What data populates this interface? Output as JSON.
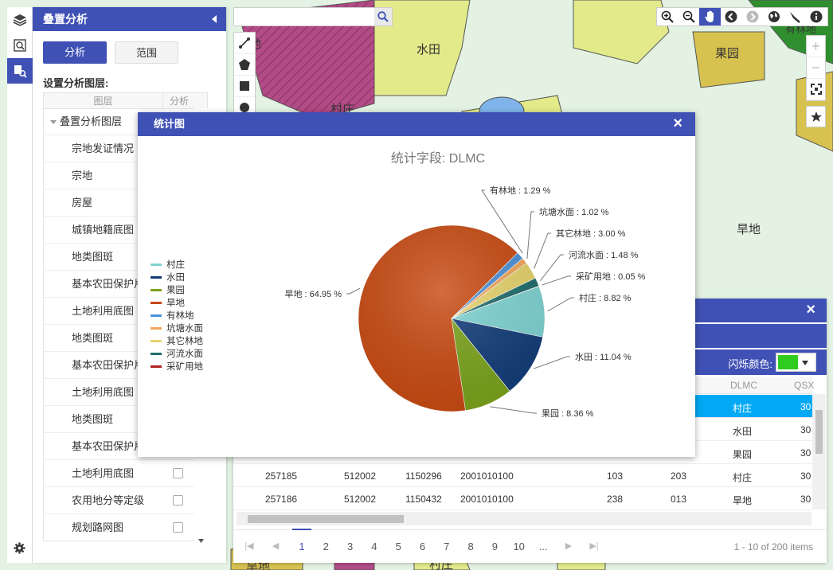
{
  "map": {
    "labels": [
      "地",
      "水田",
      "果园",
      "村庄",
      "旱地",
      "旱地",
      "村庄",
      "有林地"
    ]
  },
  "rail": {
    "icons": [
      "layers-icon",
      "search-map-icon",
      "overlay-analysis-icon",
      "gear-icon"
    ]
  },
  "panel": {
    "title": "叠置分析",
    "tabs": [
      "分析",
      "范围"
    ],
    "subtitle": "设置分析图层:",
    "col_layer": "图层",
    "col_analysis": "分析",
    "group": "叠置分析图层",
    "layers": [
      "宗地发证情况",
      "宗地",
      "房屋",
      "城镇地籍底图",
      "地类图斑",
      "基本农田保护片",
      "土地利用底图",
      "地类图斑",
      "基本农田保护片",
      "土地利用底图",
      "地类图斑",
      "基本农田保护片",
      "土地利用底图",
      "农用地分等定级",
      "规划路网图"
    ]
  },
  "search": {
    "placeholder": ""
  },
  "attr": {
    "flash_label": "闪烁颜色:",
    "flash_color": "#2ecc1e",
    "col_dlmc": "DLMC",
    "col_qsx": "QSX",
    "rows": [
      {
        "c": [
          "",
          "",
          "",
          "",
          "",
          "",
          "村庄",
          "30"
        ],
        "selected": true
      },
      {
        "c": [
          "",
          "",
          "",
          "",
          "",
          "",
          "水田",
          "30"
        ],
        "selected": false
      },
      {
        "c": [
          "",
          "",
          "",
          "",
          "",
          "",
          "果园",
          "30"
        ],
        "selected": false
      },
      {
        "c": [
          "257185",
          "512002",
          "1150296",
          "2001010100",
          "103",
          "203",
          "村庄",
          "30"
        ],
        "selected": false
      },
      {
        "c": [
          "257186",
          "512002",
          "1150432",
          "2001010100",
          "238",
          "013",
          "旱地",
          "30"
        ],
        "selected": false
      }
    ],
    "pages": [
      "1",
      "2",
      "3",
      "4",
      "5",
      "6",
      "7",
      "8",
      "9",
      "10",
      "..."
    ],
    "current_page": "1",
    "info": "1 - 10 of 200 items"
  },
  "dialog": {
    "title": "统计图",
    "close": "×"
  },
  "chart_data": {
    "type": "pie",
    "title": "统计字段: DLMC",
    "legend_position": "left",
    "slices": [
      {
        "name": "村庄",
        "value": 8.82,
        "label": "村庄 : 8.82 %",
        "color": "#7fd3d3"
      },
      {
        "name": "水田",
        "value": 11.04,
        "label": "水田 : 11.04 %",
        "color": "#123c78"
      },
      {
        "name": "果园",
        "value": 8.36,
        "label": "果园 : 8.36 %",
        "color": "#7ba31b"
      },
      {
        "name": "旱地",
        "value": 64.95,
        "label": "旱地 : 64.95 %",
        "color": "#c84a12"
      },
      {
        "name": "有林地",
        "value": 1.29,
        "label": "有林地 : 1.29 %",
        "color": "#4a90d9"
      },
      {
        "name": "坑塘水面",
        "value": 1.02,
        "label": "坑塘水面 : 1.02 %",
        "color": "#f2a65a"
      },
      {
        "name": "其它林地",
        "value": 3.0,
        "label": "其它林地 : 3.00 %",
        "color": "#e6d36b"
      },
      {
        "name": "河流水面",
        "value": 1.48,
        "label": "河流水面 : 1.48 %",
        "color": "#1f6b6b"
      },
      {
        "name": "采矿用地",
        "value": 0.05,
        "label": "采矿用地 : 0.05 %",
        "color": "#b22222"
      }
    ]
  }
}
